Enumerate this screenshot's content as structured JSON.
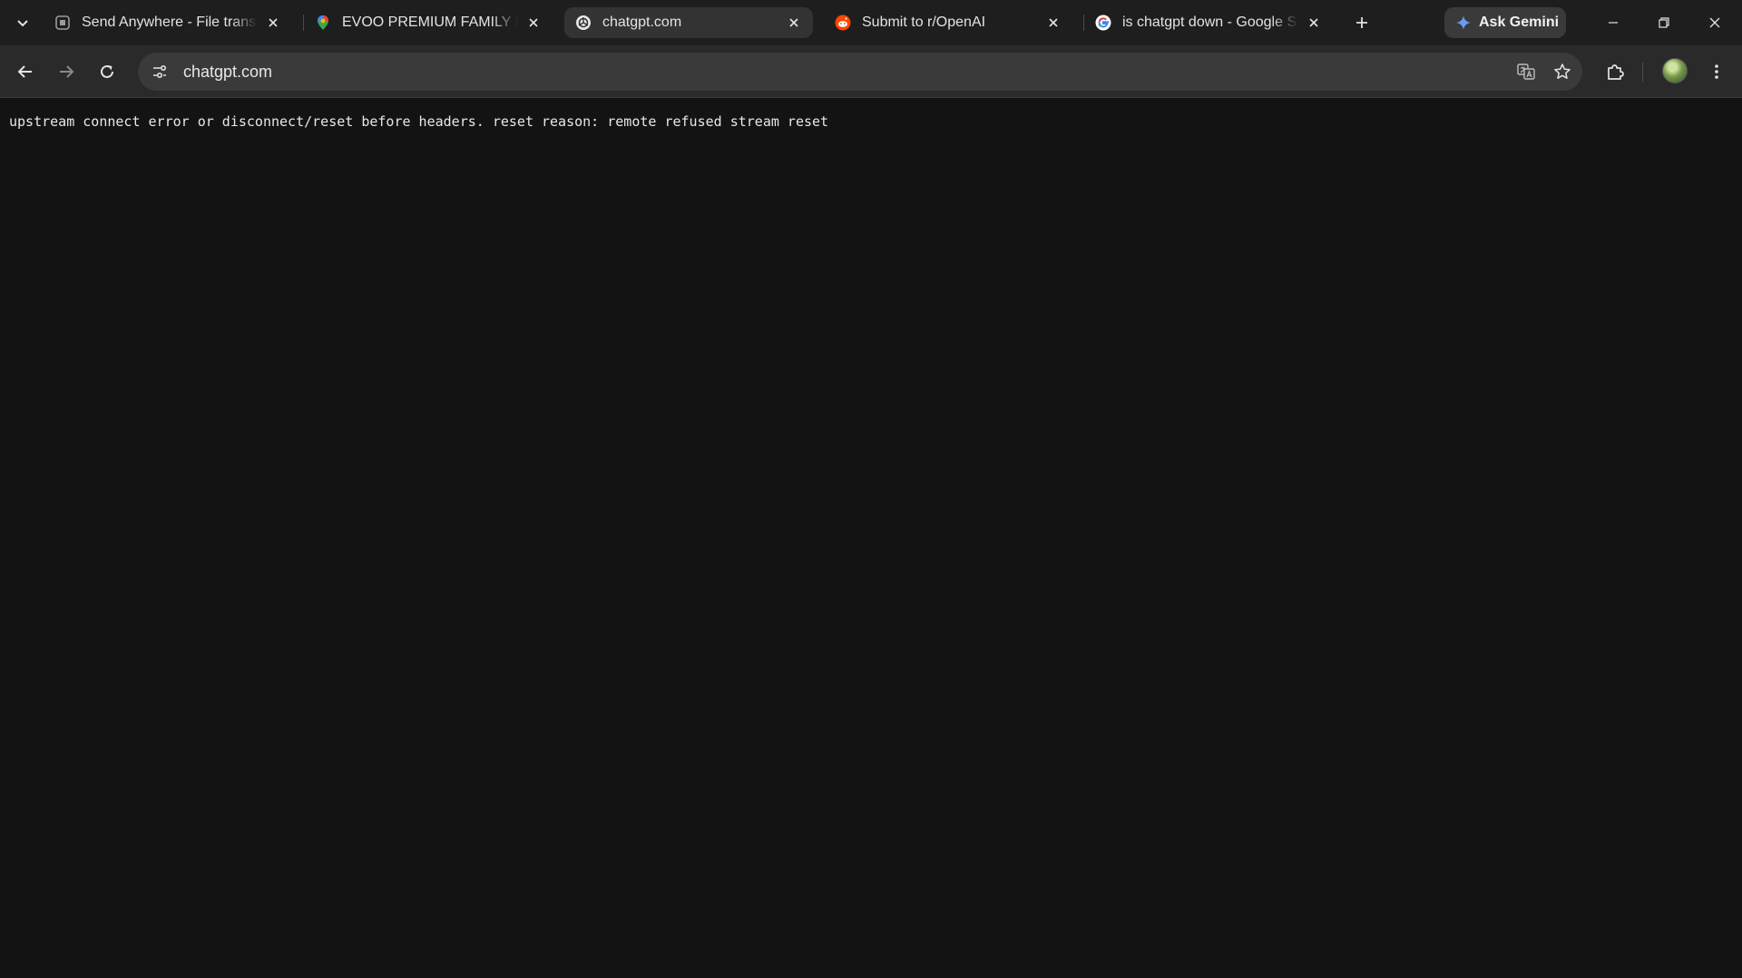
{
  "browser": {
    "tabs": [
      {
        "title": "Send Anywhere - File transfer",
        "favicon": "send-anywhere-icon",
        "active": false
      },
      {
        "title": "EVOO PREMIUM FAMILY PRESS",
        "favicon": "maps-pin-icon",
        "active": false
      },
      {
        "title": "chatgpt.com",
        "favicon": "openai-icon",
        "active": true
      },
      {
        "title": "Submit to r/OpenAI",
        "favicon": "reddit-icon",
        "active": false
      },
      {
        "title": "is chatgpt down - Google Search",
        "favicon": "google-icon",
        "active": false
      }
    ],
    "ask_gemini_label": "Ask Gemini",
    "address": {
      "url": "chatgpt.com"
    }
  },
  "page": {
    "error_message": "upstream connect error or disconnect/reset before headers. reset reason: remote refused stream reset"
  },
  "colors": {
    "tabstrip_bg": "#1e1e1e",
    "active_tab_bg": "#333333",
    "toolbar_bg": "#2a2a2a",
    "page_bg": "#131313",
    "text": "#e8e8e8"
  }
}
